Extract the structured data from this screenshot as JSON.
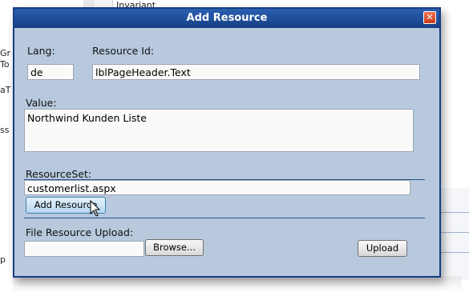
{
  "background": {
    "fragments": [
      "Invariant",
      "Gr",
      "To",
      "aT",
      "ss",
      "p"
    ]
  },
  "dialog": {
    "title": "Add Resource",
    "lang_label": "Lang:",
    "lang_value": "de",
    "resource_id_label": "Resource Id:",
    "resource_id_value": "lblPageHeader.Text",
    "value_label": "Value:",
    "value_text": "Northwind Kunden Liste",
    "resourceset_label": "ResourceSet:",
    "resourceset_value": "customerlist.aspx",
    "add_button": "Add Resource",
    "file_upload_label": "File Resource Upload:",
    "file_value": "",
    "browse_button": "Browse...",
    "upload_button": "Upload"
  },
  "icons": {
    "close": "close-icon",
    "pointer": "mouse-pointer-icon"
  }
}
